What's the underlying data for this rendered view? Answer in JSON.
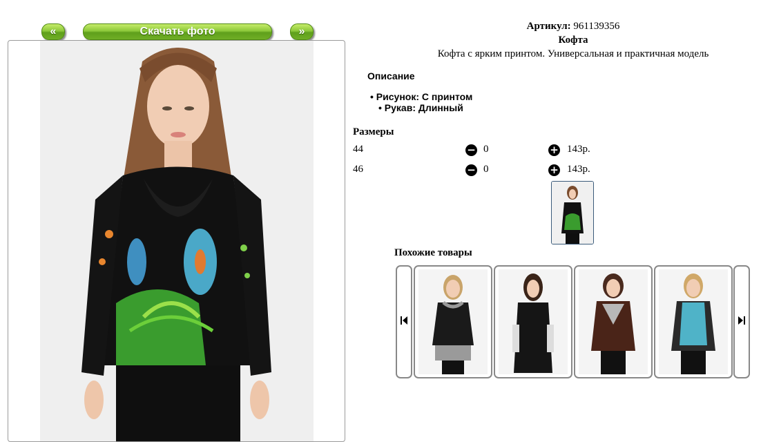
{
  "nav": {
    "prev_label": "«",
    "download_label": "Скачать фото",
    "next_label": "»"
  },
  "product": {
    "article_label": "Артикул:",
    "article_value": "961139356",
    "name": "Кофта",
    "description": "Кофта с ярким принтом. Универсальная и практичная модель"
  },
  "details": {
    "title": "Описание",
    "items": [
      "Рисунок: С принтом",
      "Рукав: Длинный"
    ]
  },
  "sizes": {
    "title": "Размеры",
    "rows": [
      {
        "size": "44",
        "qty": "0",
        "price": "143р."
      },
      {
        "size": "46",
        "qty": "0",
        "price": "143р."
      }
    ],
    "minus_icon": "minus-circle-icon",
    "plus_icon": "plus-circle-icon"
  },
  "similar": {
    "title": "Похожие товары",
    "items": [
      {
        "top_color": "#1a1a1a",
        "accent": "#9a9a9a",
        "hair": "#c9a46a"
      },
      {
        "top_color": "#151515",
        "accent": "#dddddd",
        "hair": "#3a2418"
      },
      {
        "top_color": "#4a2418",
        "accent": "#b8b8b8",
        "hair": "#4a2a1e"
      },
      {
        "top_color": "#2a2a2a",
        "accent": "#4fb3c8",
        "hair": "#d0a868"
      }
    ]
  },
  "colors": {
    "button_green": "#7dbb2e",
    "frame_border": "#9a9a9a"
  }
}
